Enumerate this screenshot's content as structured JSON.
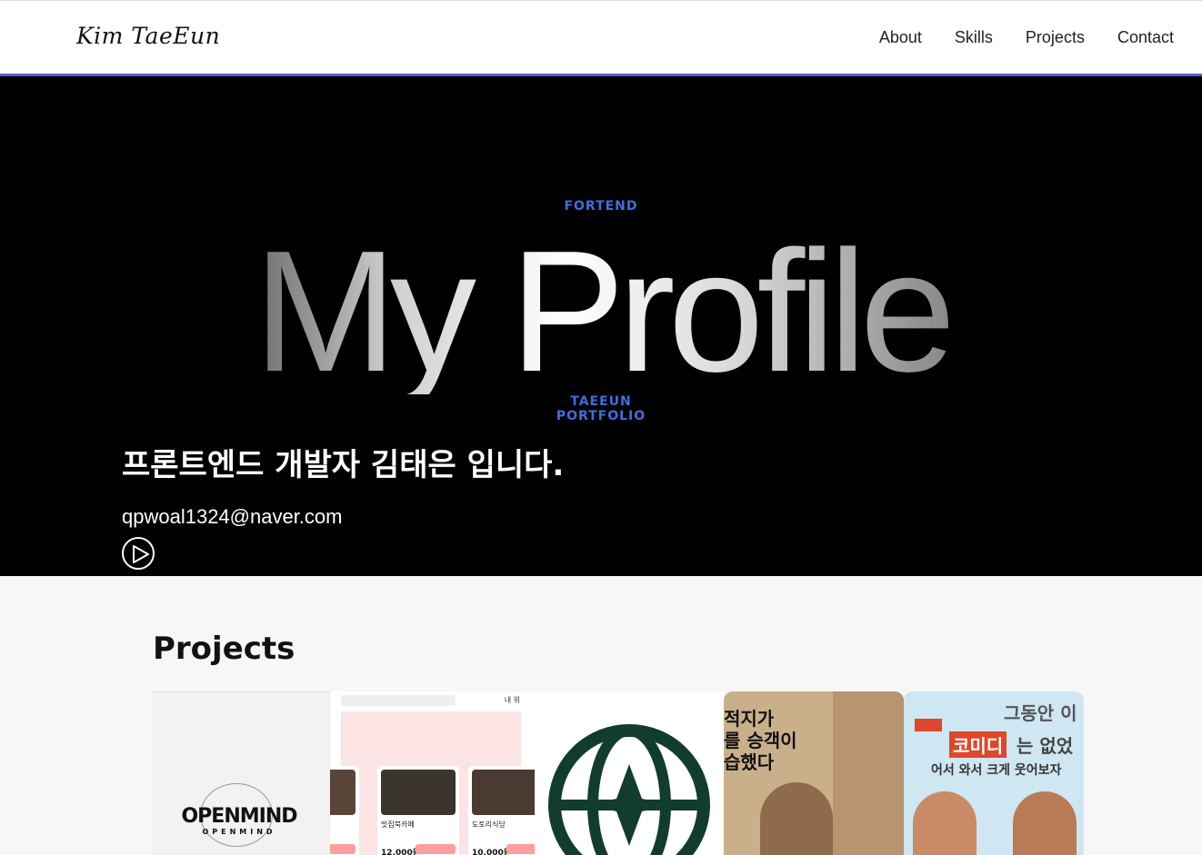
{
  "nav": {
    "logo": "Kim TaeEun",
    "links": [
      "About",
      "Skills",
      "Projects",
      "Contact"
    ]
  },
  "hero": {
    "top_label": "FORTEND",
    "title": "My Profile",
    "sub_label_1": "TAEEUN",
    "sub_label_2": "PORTFOLIO",
    "headline": "프론트엔드 개발자 김태은 입니다.",
    "email": "qpwoal1324@naver.com",
    "play_icon": "play-circle-icon"
  },
  "projects": {
    "title": "Projects",
    "cards": [
      {
        "word": "OPENMIND",
        "small": "OPENMIND"
      },
      {
        "items": [
          {
            "name": "",
            "price": ""
          },
          {
            "name": "맛집북카페",
            "price": "12,000원"
          },
          {
            "name": "도토리식당",
            "price": "10,000원"
          }
        ],
        "corner": "내 위"
      },
      {
        "icon": "globe-logo-icon"
      },
      {
        "lines": [
          "적지가",
          "를 승객이",
          "습했다"
        ]
      },
      {
        "lines": [
          "그동안 이",
          "코미디",
          "는 없었",
          "어서 와서 크게 웃어보자"
        ]
      }
    ]
  },
  "colors": {
    "accent": "#5b57d6",
    "hero_label": "#3d6fe0"
  }
}
